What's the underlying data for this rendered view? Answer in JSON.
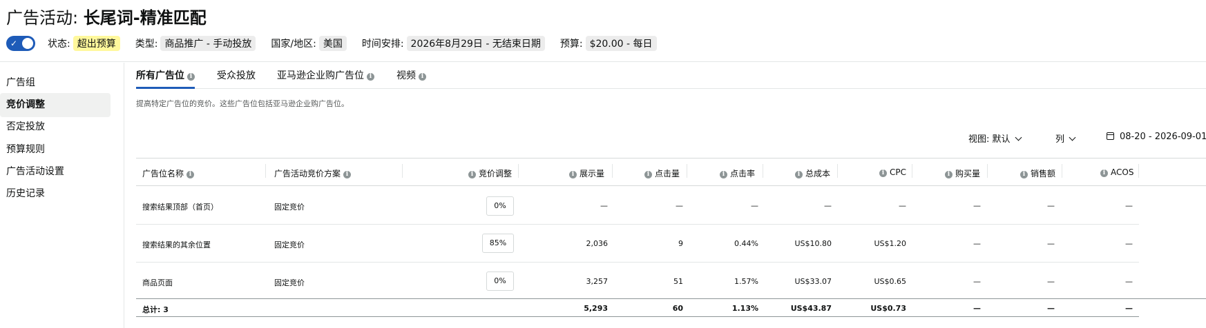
{
  "header": {
    "title_prefix": "广告活动:",
    "title_name": "长尾词-精准匹配",
    "status_label": "状态:",
    "status_value": "超出预算",
    "type_label": "类型:",
    "type_value": "商品推广 - 手动投放",
    "region_label": "国家/地区:",
    "region_value": "美国",
    "schedule_label": "时间安排:",
    "schedule_value": "2026年8月29日 - 无结束日期",
    "budget_label": "预算:",
    "budget_value": "$20.00 - 每日",
    "toggle_on": true
  },
  "sidebar": {
    "items": [
      {
        "label": "广告组"
      },
      {
        "label": "竞价调整"
      },
      {
        "label": "否定投放"
      },
      {
        "label": "预算规则"
      },
      {
        "label": "广告活动设置"
      },
      {
        "label": "历史记录"
      }
    ],
    "active": "竞价调整"
  },
  "tabs": [
    {
      "label": "所有广告位"
    },
    {
      "label": "受众投放"
    },
    {
      "label": "亚马逊企业购广告位"
    },
    {
      "label": "视频"
    }
  ],
  "description": "提高特定广告位的竞价。这些广告位包括亚马逊企业购广告位。",
  "toolbar": {
    "view_label": "视图:",
    "view_value": "默认",
    "columns_label": "列",
    "date_range": "08-20 - 2026-09-01"
  },
  "table": {
    "columns": [
      "广告位名称",
      "广告活动竞价方案",
      "竞价调整",
      "展示量",
      "点击量",
      "点击率",
      "总成本",
      "CPC",
      "购买量",
      "销售额",
      "ACOS"
    ],
    "rows": [
      {
        "placement": "搜索结果顶部（首页）",
        "strategy": "固定竞价",
        "bid": "0%",
        "impressions": "—",
        "clicks": "—",
        "ctr": "—",
        "cost": "—",
        "cpc": "—",
        "purchases": "—",
        "sales": "—",
        "acos": "—"
      },
      {
        "placement": "搜索结果的其余位置",
        "strategy": "固定竞价",
        "bid": "85%",
        "impressions": "2,036",
        "clicks": "9",
        "ctr": "0.44%",
        "cost": "US$10.80",
        "cpc": "US$1.20",
        "purchases": "—",
        "sales": "—",
        "acos": "—"
      },
      {
        "placement": "商品页面",
        "strategy": "固定竞价",
        "bid": "0%",
        "impressions": "3,257",
        "clicks": "51",
        "ctr": "1.57%",
        "cost": "US$33.07",
        "cpc": "US$0.65",
        "purchases": "—",
        "sales": "—",
        "acos": "—"
      }
    ],
    "total": {
      "label": "总计: 3",
      "impressions": "5,293",
      "clicks": "60",
      "ctr": "1.13%",
      "cost": "US$43.87",
      "cpc": "US$0.73",
      "purchases": "—",
      "sales": "—",
      "acos": "—"
    }
  },
  "colors": {
    "accent": "#1e5bb8",
    "warn_chip": "#fff89c",
    "chip": "#ececec"
  }
}
